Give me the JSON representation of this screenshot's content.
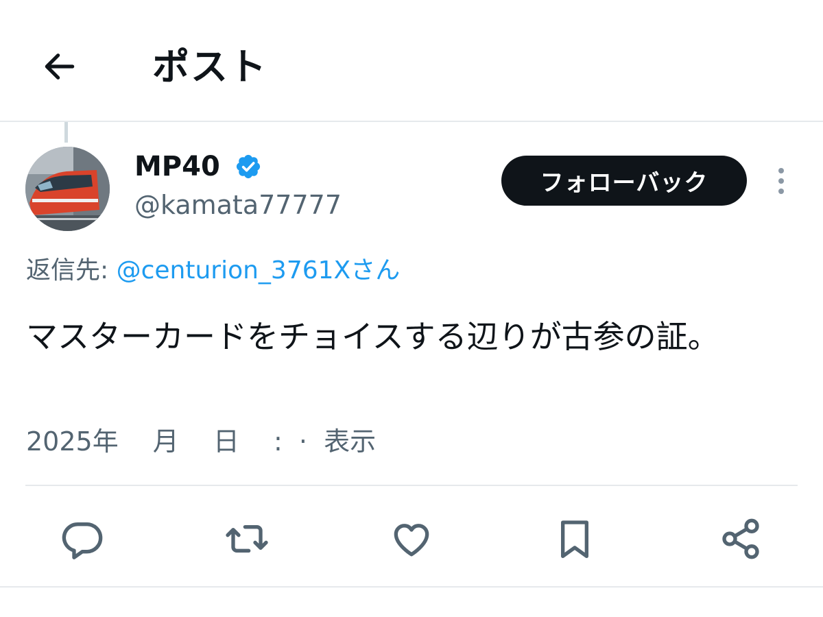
{
  "header": {
    "back_icon": "arrow-left-icon",
    "title": "ポスト"
  },
  "author": {
    "display_name": "MP40",
    "verified": true,
    "handle": "@kamata77777",
    "avatar": "train-photo"
  },
  "follow_button": {
    "label": "フォローバック"
  },
  "more_icon": "more-vertical-icon",
  "reply_to": {
    "prefix": "返信先: ",
    "mention": "@centurion_3761Xさん"
  },
  "tweet": {
    "text": "マスターカードをチョイスする辺りが古参の証。"
  },
  "meta": {
    "date": "2025年　 月　 日　 :  ·  ",
    "views_label": "表示"
  },
  "actions": [
    {
      "icon": "reply-icon"
    },
    {
      "icon": "repost-icon"
    },
    {
      "icon": "like-icon"
    },
    {
      "icon": "bookmark-icon"
    },
    {
      "icon": "share-icon"
    }
  ],
  "colors": {
    "accent": "#1d9bf0",
    "text": "#0f1419",
    "muted": "#536471",
    "divider": "#e6e9ec",
    "follow_button_bg": "#0f1419"
  }
}
